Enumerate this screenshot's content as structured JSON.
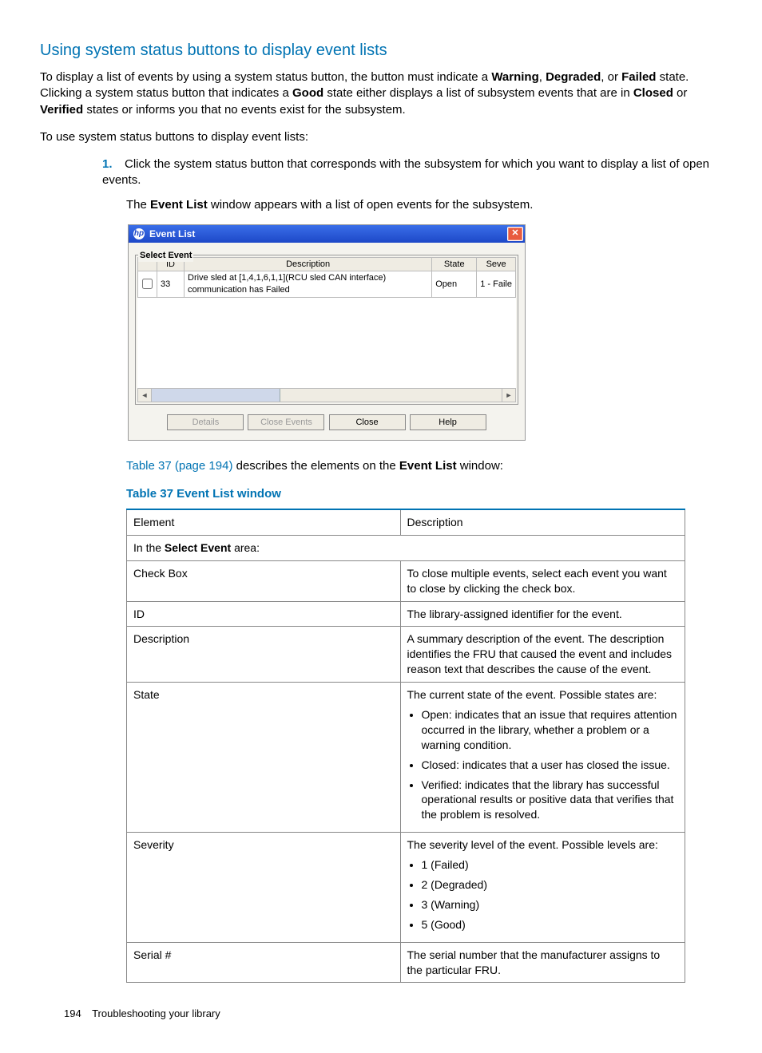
{
  "heading": "Using system status buttons to display event lists",
  "para1_pre": "To display a list of events by using a system status button, the button must indicate a ",
  "para1_b1": "Warning",
  "para1_mid1": ", ",
  "para1_b2": "Degraded",
  "para1_mid2": ", or ",
  "para1_b3": "Failed",
  "para1_mid3": " state. Clicking a system status button that indicates a ",
  "para1_b4": "Good",
  "para1_mid4": " state either displays a list of subsystem events that are in ",
  "para1_b5": "Closed",
  "para1_mid5": " or ",
  "para1_b6": "Verified",
  "para1_post": " states or informs you that no events exist for the subsystem.",
  "para2": "To use system status buttons to display event lists:",
  "step1_num": "1.",
  "step1_text": "Click the system status button that corresponds with the subsystem for which you want to display a list of open events.",
  "step1_body_pre": "The ",
  "step1_body_b": "Event List",
  "step1_body_post": " window appears with a list of open events for the subsystem.",
  "win": {
    "title": "Event List",
    "logo": "hp",
    "fieldset_label": "Select Event",
    "cols": {
      "chk": "",
      "id": "ID",
      "desc": "Description",
      "state": "State",
      "sev": "Seve"
    },
    "row": {
      "id": "33",
      "desc": "Drive sled at [1,4,1,6,1,1](RCU sled CAN interface) communication has Failed",
      "state": "Open",
      "sev": "1 - Faile"
    },
    "btns": {
      "details": "Details",
      "close_events": "Close Events",
      "close": "Close",
      "help": "Help"
    }
  },
  "caption_ref_pre": "",
  "caption_ref_link": "Table 37 (page 194)",
  "caption_ref_mid": " describes the elements on the ",
  "caption_ref_b": "Event List",
  "caption_ref_post": " window:",
  "tbl_caption": "Table 37 Event List window",
  "tbl": {
    "h1": "Element",
    "h2": "Description",
    "row_span_pre": "In the ",
    "row_span_b": "Select Event",
    "row_span_post": " area:",
    "r1e": "Check Box",
    "r1d": "To close multiple events, select each event you want to close by clicking the check box.",
    "r2e": "ID",
    "r2d": "The library-assigned identifier for the event.",
    "r3e": "Description",
    "r3d": "A summary description of the event. The description identifies the FRU that caused the event and includes reason text that describes the cause of the event.",
    "r4e": "State",
    "r4d_lead": "The current state of the event. Possible states are:",
    "r4d_li1": "Open: indicates that an issue that requires attention occurred in the library, whether a problem or a warning condition.",
    "r4d_li2": "Closed: indicates that a user has closed the issue.",
    "r4d_li3": "Verified: indicates that the library has successful operational results or positive data that verifies that the problem is resolved.",
    "r5e": "Severity",
    "r5d_lead": "The severity level of the event. Possible levels are:",
    "r5d_li1": "1 (Failed)",
    "r5d_li2": "2 (Degraded)",
    "r5d_li3": "3 (Warning)",
    "r5d_li4": "5 (Good)",
    "r6e": "Serial #",
    "r6d": "The serial number that the manufacturer assigns to the particular FRU."
  },
  "footer_page": "194",
  "footer_text": "Troubleshooting your library"
}
